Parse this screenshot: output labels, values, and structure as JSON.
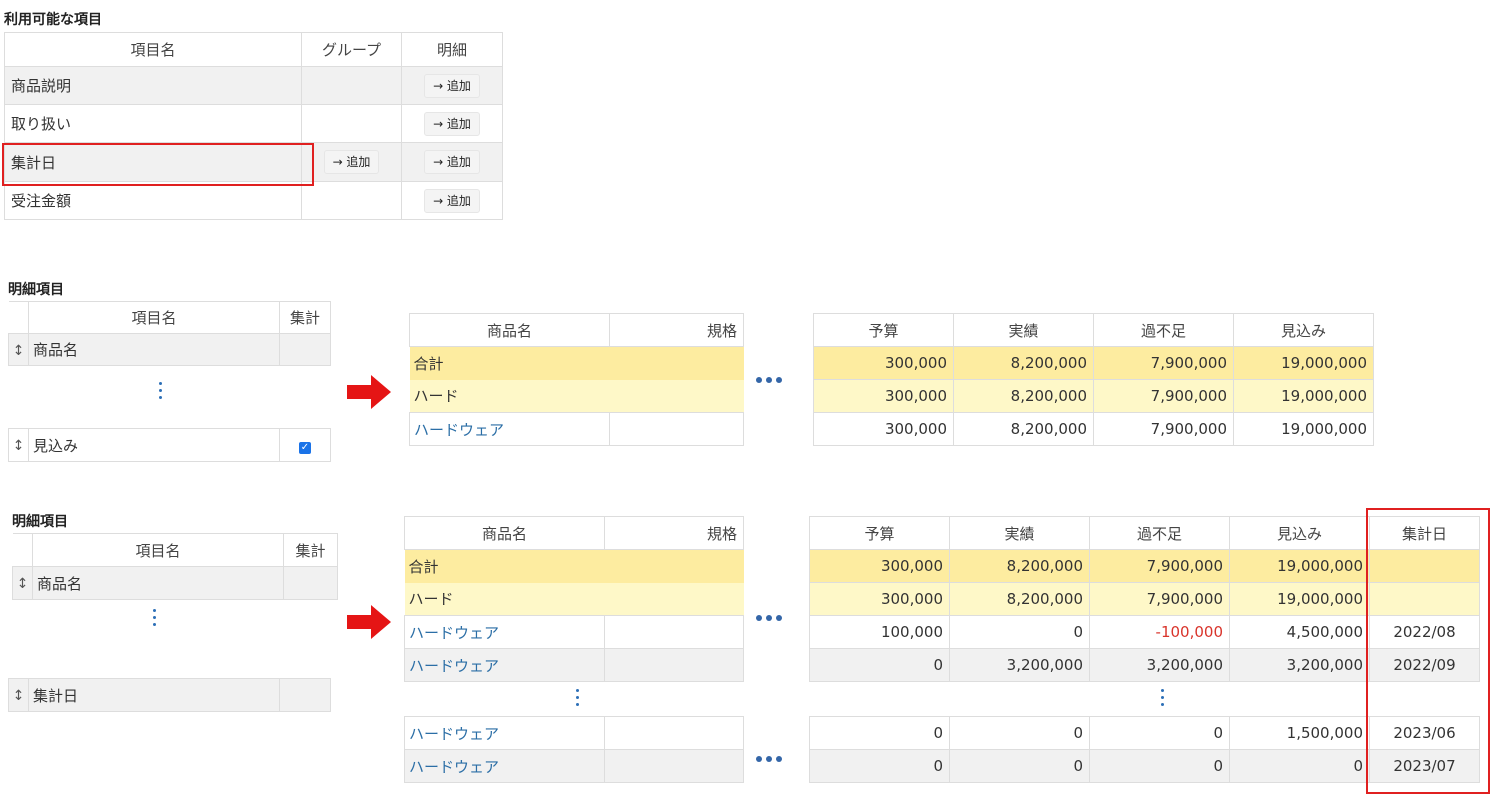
{
  "available": {
    "title": "利用可能な項目",
    "headers": [
      "項目名",
      "グループ",
      "明細"
    ],
    "rows": [
      {
        "name": "商品説明",
        "group_btn": "",
        "detail_btn": "→ 追加"
      },
      {
        "name": "取り扱い",
        "group_btn": "",
        "detail_btn": "→ 追加"
      },
      {
        "name": "集計日",
        "group_btn": "→ 追加",
        "detail_btn": "→ 追加"
      },
      {
        "name": "受注金額",
        "group_btn": "",
        "detail_btn": "→ 追加"
      }
    ]
  },
  "detail1": {
    "title": "明細項目",
    "headers": [
      "項目名",
      "集計"
    ],
    "row_first": "商品名",
    "row_last": "見込み",
    "checkbox_checked": true
  },
  "detail2": {
    "title": "明細項目",
    "headers": [
      "項目名",
      "集計"
    ],
    "row_first": "商品名",
    "row_last": "集計日"
  },
  "grid1": {
    "left_headers": [
      "商品名",
      "規格"
    ],
    "left_rows": [
      "合計",
      "ハード",
      "ハードウェア"
    ],
    "right_headers": [
      "予算",
      "実績",
      "過不足",
      "見込み"
    ],
    "right_rows": [
      [
        "300,000",
        "8,200,000",
        "7,900,000",
        "19,000,000"
      ],
      [
        "300,000",
        "8,200,000",
        "7,900,000",
        "19,000,000"
      ],
      [
        "300,000",
        "8,200,000",
        "7,900,000",
        "19,000,000"
      ]
    ]
  },
  "grid2": {
    "left_headers": [
      "商品名",
      "規格"
    ],
    "left_rows_top": [
      "合計",
      "ハード",
      "ハードウェア",
      "ハードウェア"
    ],
    "left_rows_bottom": [
      "ハードウェア",
      "ハードウェア"
    ],
    "right_headers": [
      "予算",
      "実績",
      "過不足",
      "見込み",
      "集計日"
    ],
    "right_rows_top": [
      [
        "300,000",
        "8,200,000",
        "7,900,000",
        "19,000,000",
        ""
      ],
      [
        "300,000",
        "8,200,000",
        "7,900,000",
        "19,000,000",
        ""
      ],
      [
        "100,000",
        "0",
        "-100,000",
        "4,500,000",
        "2022/08"
      ],
      [
        "0",
        "3,200,000",
        "3,200,000",
        "3,200,000",
        "2022/09"
      ]
    ],
    "right_rows_bottom": [
      [
        "0",
        "0",
        "0",
        "1,500,000",
        "2023/06"
      ],
      [
        "0",
        "0",
        "0",
        "0",
        "2023/07"
      ]
    ]
  },
  "colors": {
    "highlight": "#e02020",
    "link": "#2b6ea6",
    "negative": "#d9342b"
  }
}
